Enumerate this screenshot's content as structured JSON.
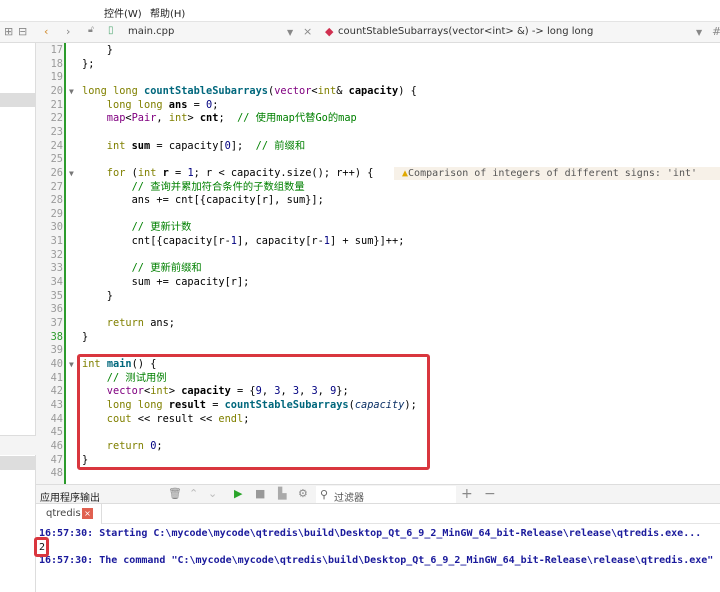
{
  "menu": {
    "items": [
      "控件(W)",
      "帮助(H)"
    ]
  },
  "toolbar": {
    "file": "main.cpp",
    "function": "countStableSubarrays(vector<int> &) -> long long",
    "close": "×",
    "back": "‹",
    "forward": "›"
  },
  "editor": {
    "lines": [
      {
        "n": "17",
        "t": [
          [
            "pl",
            "    }"
          ]
        ]
      },
      {
        "n": "18",
        "t": [
          [
            "pl",
            "};"
          ]
        ]
      },
      {
        "n": "19",
        "t": []
      },
      {
        "n": "20",
        "fold": true,
        "t": [
          [
            "kw",
            "long long "
          ],
          [
            "fn",
            "countStableSubarrays"
          ],
          [
            "pl",
            "("
          ],
          [
            "ty",
            "vector"
          ],
          [
            "pl",
            "<"
          ],
          [
            "kw",
            "int"
          ],
          [
            "pl",
            "& "
          ],
          [
            "bd",
            "capacity"
          ],
          [
            "pl",
            ") {"
          ]
        ]
      },
      {
        "n": "21",
        "t": [
          [
            "kw",
            "    long long "
          ],
          [
            "bd",
            "ans"
          ],
          [
            "pl",
            " = "
          ],
          [
            "nm",
            "0"
          ],
          [
            "pl",
            ";"
          ]
        ]
      },
      {
        "n": "22",
        "t": [
          [
            "ty",
            "    map"
          ],
          [
            "pl",
            "<"
          ],
          [
            "ty",
            "Pair"
          ],
          [
            "pl",
            ", "
          ],
          [
            "kw",
            "int"
          ],
          [
            "pl",
            "> "
          ],
          [
            "bd",
            "cnt"
          ],
          [
            "pl",
            ";  "
          ],
          [
            "cm",
            "// 使用map代替Go的map"
          ]
        ]
      },
      {
        "n": "23",
        "t": []
      },
      {
        "n": "24",
        "t": [
          [
            "kw",
            "    int "
          ],
          [
            "bd",
            "sum"
          ],
          [
            "pl",
            " = capacity["
          ],
          [
            "nm",
            "0"
          ],
          [
            "pl",
            "];  "
          ],
          [
            "cm",
            "// 前缀和"
          ]
        ]
      },
      {
        "n": "25",
        "t": []
      },
      {
        "n": "26",
        "fold": true,
        "t": [
          [
            "kw",
            "    for"
          ],
          [
            "pl",
            " ("
          ],
          [
            "kw",
            "int "
          ],
          [
            "bd",
            "r"
          ],
          [
            "pl",
            " = "
          ],
          [
            "nm",
            "1"
          ],
          [
            "pl",
            "; r < capacity.size(); r++) {"
          ]
        ]
      },
      {
        "n": "27",
        "t": [
          [
            "cm",
            "        // 查询并累加符合条件的子数组数量"
          ]
        ]
      },
      {
        "n": "28",
        "t": [
          [
            "pl",
            "        ans += cnt[{capacity[r], sum}];"
          ]
        ]
      },
      {
        "n": "29",
        "t": []
      },
      {
        "n": "30",
        "t": [
          [
            "cm",
            "        // 更新计数"
          ]
        ]
      },
      {
        "n": "31",
        "t": [
          [
            "pl",
            "        cnt[{capacity[r-"
          ],
          [
            "nm",
            "1"
          ],
          [
            "pl",
            "], capacity[r-"
          ],
          [
            "nm",
            "1"
          ],
          [
            "pl",
            "] + sum}]++;"
          ]
        ]
      },
      {
        "n": "32",
        "t": []
      },
      {
        "n": "33",
        "t": [
          [
            "cm",
            "        // 更新前缀和"
          ]
        ]
      },
      {
        "n": "34",
        "t": [
          [
            "pl",
            "        sum += capacity[r];"
          ]
        ]
      },
      {
        "n": "35",
        "t": [
          [
            "pl",
            "    }"
          ]
        ]
      },
      {
        "n": "36",
        "t": []
      },
      {
        "n": "37",
        "t": [
          [
            "kw",
            "    return "
          ],
          [
            "pl",
            "ans;"
          ]
        ]
      },
      {
        "n": "38",
        "t": [
          [
            "pl",
            "}"
          ]
        ]
      },
      {
        "n": "39",
        "t": []
      },
      {
        "n": "40",
        "fold": true,
        "t": [
          [
            "kw",
            "int "
          ],
          [
            "fn",
            "main"
          ],
          [
            "pl",
            "() {"
          ]
        ]
      },
      {
        "n": "41",
        "t": [
          [
            "cm",
            "    // 测试用例"
          ]
        ]
      },
      {
        "n": "42",
        "t": [
          [
            "ty",
            "    vector"
          ],
          [
            "pl",
            "<"
          ],
          [
            "kw",
            "int"
          ],
          [
            "pl",
            "> "
          ],
          [
            "bd",
            "capacity"
          ],
          [
            "pl",
            " = {"
          ],
          [
            "nm",
            "9"
          ],
          [
            "pl",
            ", "
          ],
          [
            "nm",
            "3"
          ],
          [
            "pl",
            ", "
          ],
          [
            "nm",
            "3"
          ],
          [
            "pl",
            ", "
          ],
          [
            "nm",
            "3"
          ],
          [
            "pl",
            ", "
          ],
          [
            "nm",
            "9"
          ],
          [
            "pl",
            "};"
          ]
        ]
      },
      {
        "n": "43",
        "t": [
          [
            "kw",
            "    long long "
          ],
          [
            "bd",
            "result"
          ],
          [
            "pl",
            " = "
          ],
          [
            "fn",
            "countStableSubarrays"
          ],
          [
            "pl",
            "("
          ],
          [
            "it",
            "capacity"
          ],
          [
            "pl",
            ");"
          ]
        ]
      },
      {
        "n": "44",
        "t": [
          [
            "kw",
            "    cout"
          ],
          [
            "pl",
            " << result << "
          ],
          [
            "kw",
            "endl"
          ],
          [
            "pl",
            ";"
          ]
        ]
      },
      {
        "n": "45",
        "t": []
      },
      {
        "n": "46",
        "t": [
          [
            "kw",
            "    return "
          ],
          [
            "nm",
            "0"
          ],
          [
            "pl",
            ";"
          ]
        ]
      },
      {
        "n": "47",
        "t": [
          [
            "pl",
            "}"
          ]
        ]
      },
      {
        "n": "48",
        "t": []
      }
    ],
    "warning": "Comparison of integers of different signs: 'int'"
  },
  "output": {
    "title": "应用程序输出",
    "filter": "过滤器",
    "tab": "qtredis",
    "lines": [
      "16:57:30: Starting C:\\mycode\\mycode\\qtredis\\build\\Desktop_Qt_6_9_2_MinGW_64_bit-Release\\release\\qtredis.exe...",
      "2",
      "16:57:30: The command \"C:\\mycode\\mycode\\qtredis\\build\\Desktop_Qt_6_9_2_MinGW_64_bit-Release\\release\\qtredis.exe\""
    ]
  }
}
